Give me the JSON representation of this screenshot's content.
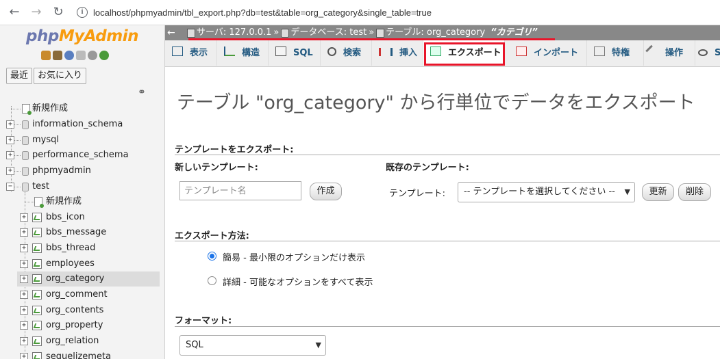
{
  "browser": {
    "url": "localhost/phpmyadmin/tbl_export.php?db=test&table=org_category&single_table=true"
  },
  "sidebar": {
    "logo_php": "php",
    "logo_myadmin": "MyAdmin",
    "recent_label": "最近",
    "favorites_label": "お気に入り",
    "tree": [
      {
        "label": "新規作成",
        "type": "new",
        "level": 0
      },
      {
        "label": "information_schema",
        "type": "db",
        "level": 0
      },
      {
        "label": "mysql",
        "type": "db",
        "level": 0
      },
      {
        "label": "performance_schema",
        "type": "db",
        "level": 0
      },
      {
        "label": "phpmyadmin",
        "type": "db",
        "level": 0
      },
      {
        "label": "test",
        "type": "db",
        "level": 0,
        "expanded": true
      },
      {
        "label": "新規作成",
        "type": "new",
        "level": 1
      },
      {
        "label": "bbs_icon",
        "type": "table",
        "level": 1
      },
      {
        "label": "bbs_message",
        "type": "table",
        "level": 1
      },
      {
        "label": "bbs_thread",
        "type": "table",
        "level": 1
      },
      {
        "label": "employees",
        "type": "table",
        "level": 1
      },
      {
        "label": "org_category",
        "type": "table",
        "level": 1,
        "selected": true
      },
      {
        "label": "org_comment",
        "type": "table",
        "level": 1
      },
      {
        "label": "org_contents",
        "type": "table",
        "level": 1
      },
      {
        "label": "org_property",
        "type": "table",
        "level": 1
      },
      {
        "label": "org_relation",
        "type": "table",
        "level": 1
      },
      {
        "label": "sequelizemeta",
        "type": "table",
        "level": 1
      }
    ]
  },
  "breadcrumb": {
    "server": "サーバ: 127.0.0.1",
    "database": "データベース: test",
    "table": "テーブル: org_category",
    "comment": "“カテゴリ”"
  },
  "tabs": [
    {
      "label": "表示"
    },
    {
      "label": "構造"
    },
    {
      "label": "SQL"
    },
    {
      "label": "検索"
    },
    {
      "label": "挿入"
    },
    {
      "label": "エクスポート",
      "active": true
    },
    {
      "label": "インポート"
    },
    {
      "label": "特権"
    },
    {
      "label": "操作"
    },
    {
      "label": "S"
    }
  ],
  "main": {
    "title": "テーブル \"org_category\" から行単位でデータをエクスポート",
    "template_section": "テンプレートをエクスポート:",
    "new_template_label": "新しいテンプレート:",
    "template_name_placeholder": "テンプレート名",
    "create_button": "作成",
    "existing_template_label": "既存のテンプレート:",
    "template_label": "テンプレート:",
    "template_select": "-- テンプレートを選択してください --",
    "update_button": "更新",
    "delete_button": "削除",
    "method_section": "エクスポート方法:",
    "method_quick": "簡易 - 最小限のオプションだけ表示",
    "method_custom": "詳細 - 可能なオプションをすべて表示",
    "format_section": "フォーマット:",
    "format_select": "SQL"
  },
  "colors": {
    "highlight_red": "#e8152a",
    "link_blue": "#235a81",
    "topbar_gray": "#888888"
  }
}
